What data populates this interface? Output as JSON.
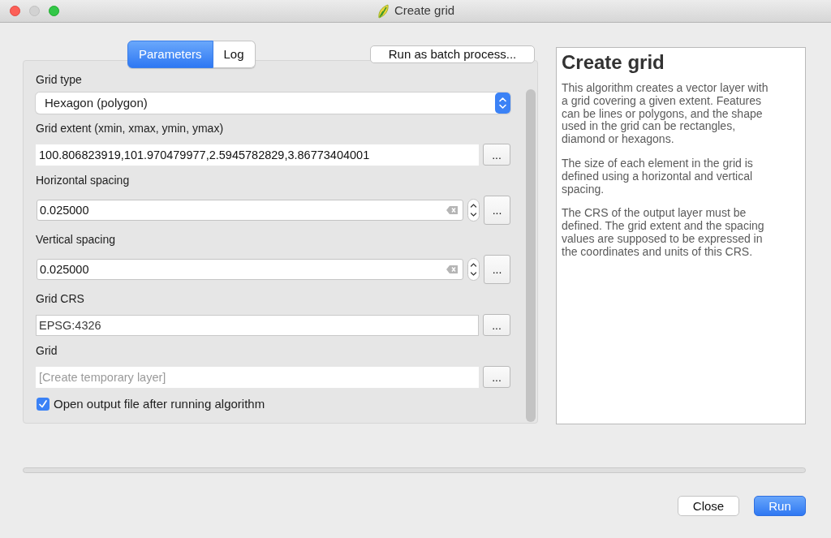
{
  "window": {
    "title": "Create grid",
    "buttons": [
      {
        "kind": "close",
        "disabled": false
      },
      {
        "kind": "minimize",
        "disabled": true
      },
      {
        "kind": "zoom",
        "disabled": false
      }
    ]
  },
  "tabs": [
    {
      "label": "Parameters",
      "selected": true
    },
    {
      "label": "Log",
      "selected": false
    }
  ],
  "batch_button": "Run as batch process...",
  "parameters": [
    {
      "kind": "select",
      "label": "Grid type",
      "value": "Hexagon (polygon)"
    },
    {
      "kind": "text",
      "label": "Grid extent (xmin, xmax, ymin, ymax)",
      "value": "100.806823919,101.970479977,2.5945782829,3.86773404001",
      "button": "..."
    },
    {
      "kind": "number",
      "label": "Horizontal spacing",
      "value": "0.025000",
      "button": "..."
    },
    {
      "kind": "number",
      "label": "Vertical spacing",
      "value": "0.025000",
      "button": "..."
    },
    {
      "kind": "crs",
      "label": "Grid CRS",
      "value": "EPSG:4326",
      "button": "..."
    },
    {
      "kind": "output",
      "label": "Grid",
      "placeholder": "[Create temporary layer]",
      "button": "..."
    }
  ],
  "open_output": {
    "label": "Open output file after running algorithm",
    "checked": true
  },
  "help": {
    "title": "Create grid",
    "paragraphs": [
      "This algorithm creates a vector layer with\na grid covering a given extent. Features\ncan be lines or polygons, and the shape\nused in the grid can be rectangles,\ndiamond or hexagons.",
      "The size of each element in the grid is\ndefined using a horizontal and vertical\nspacing.",
      "The CRS of the output layer must be\ndefined. The grid extent and the spacing\nvalues are supposed to be expressed in\nthe coordinates and units of this CRS."
    ]
  },
  "progress": {
    "level": 0
  },
  "buttons": [
    {
      "label": "Close",
      "kind": "default"
    },
    {
      "label": "Run",
      "kind": "primary"
    }
  ]
}
